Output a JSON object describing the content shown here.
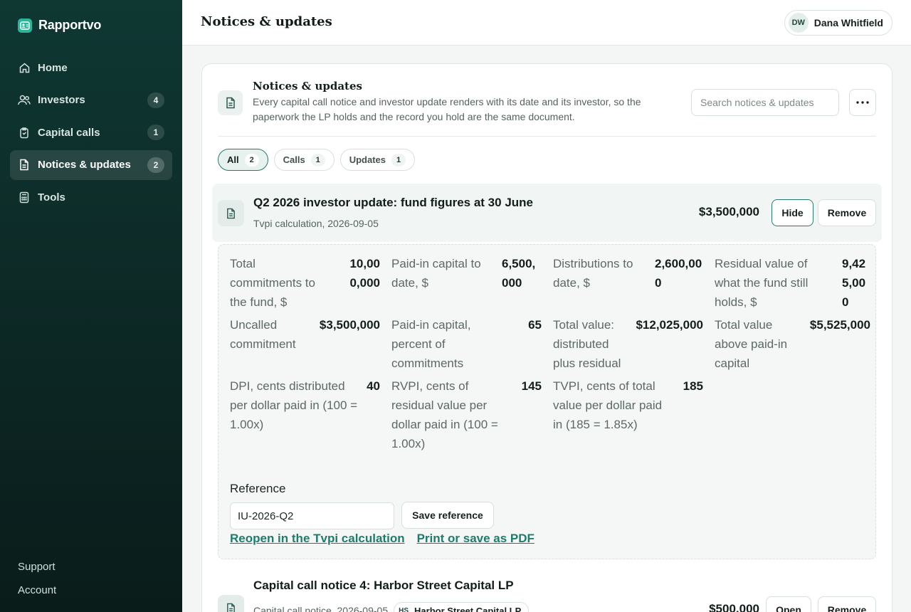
{
  "app": {
    "name": "Rapportvo"
  },
  "sidebar": {
    "items": [
      {
        "label": "Home",
        "icon": "home-icon",
        "badge": ""
      },
      {
        "label": "Investors",
        "icon": "users-icon",
        "badge": "4"
      },
      {
        "label": "Capital calls",
        "icon": "clipboard-icon",
        "badge": "1"
      },
      {
        "label": "Notices & updates",
        "icon": "document-icon",
        "badge": "2",
        "active": true
      },
      {
        "label": "Tools",
        "icon": "calculator-icon",
        "badge": ""
      }
    ],
    "footer": {
      "support": "Support",
      "account": "Account"
    }
  },
  "header": {
    "title": "Notices & updates",
    "user": {
      "initials": "DW",
      "name": "Dana Whitfield"
    }
  },
  "panel": {
    "title": "Notices & updates",
    "description": "Every capital call notice and investor update renders with its date and its investor, so the paperwork the LP holds and the record you hold are the same document.",
    "search_placeholder": "Search notices & updates",
    "filters": [
      {
        "label": "All",
        "count": "2",
        "active": true
      },
      {
        "label": "Calls",
        "count": "1"
      },
      {
        "label": "Updates",
        "count": "1"
      }
    ]
  },
  "notices": [
    {
      "title": "Q2 2026 investor update: fund figures at 30 June",
      "subtitle": "Tvpi calculation, 2026-09-05",
      "amount": "$3,500,000",
      "hide_label": "Hide",
      "remove_label": "Remove",
      "metrics": [
        {
          "label": "Total commitments to the fund, $",
          "value": "10,000,000"
        },
        {
          "label": "Paid-in capital to date, $",
          "value": "6,500,000"
        },
        {
          "label": "Distributions to date, $",
          "value": "2,600,000"
        },
        {
          "label": "Residual value of what the fund still holds, $",
          "value": "9,425,000"
        },
        {
          "label": "Uncalled commitment",
          "value": "$3,500,000"
        },
        {
          "label": "Paid-in capital, percent of commitments",
          "value": "65"
        },
        {
          "label": "Total value: distributed plus residual",
          "value": "$12,025,000"
        },
        {
          "label": "Total value above paid-in capital",
          "value": "$5,525,000"
        },
        {
          "label": "DPI, cents distributed per dollar paid in (100 = 1.00x)",
          "value": "40"
        },
        {
          "label": "RVPI, cents of residual value per dollar paid in (100 = 1.00x)",
          "value": "145"
        },
        {
          "label": "TVPI, cents of total value per dollar paid in (185 = 1.85x)",
          "value": "185"
        }
      ],
      "reference_label": "Reference",
      "reference_value": "IU-2026-Q2",
      "save_reference_label": "Save reference",
      "reopen_link": "Reopen in the Tvpi calculation",
      "print_link": "Print or save as PDF"
    },
    {
      "title": "Capital call notice 4: Harbor Street Capital LP",
      "subtitle": "Capital call notice, 2026-09-05",
      "investor": {
        "initials": "HS",
        "name": "Harbor Street Capital LP"
      },
      "amount": "$500,000",
      "open_label": "Open",
      "remove_label": "Remove"
    }
  ],
  "colors": {
    "accent": "#1e7c6c",
    "sidebar": "#0f3833",
    "brand_logo": "#2bb59a"
  }
}
